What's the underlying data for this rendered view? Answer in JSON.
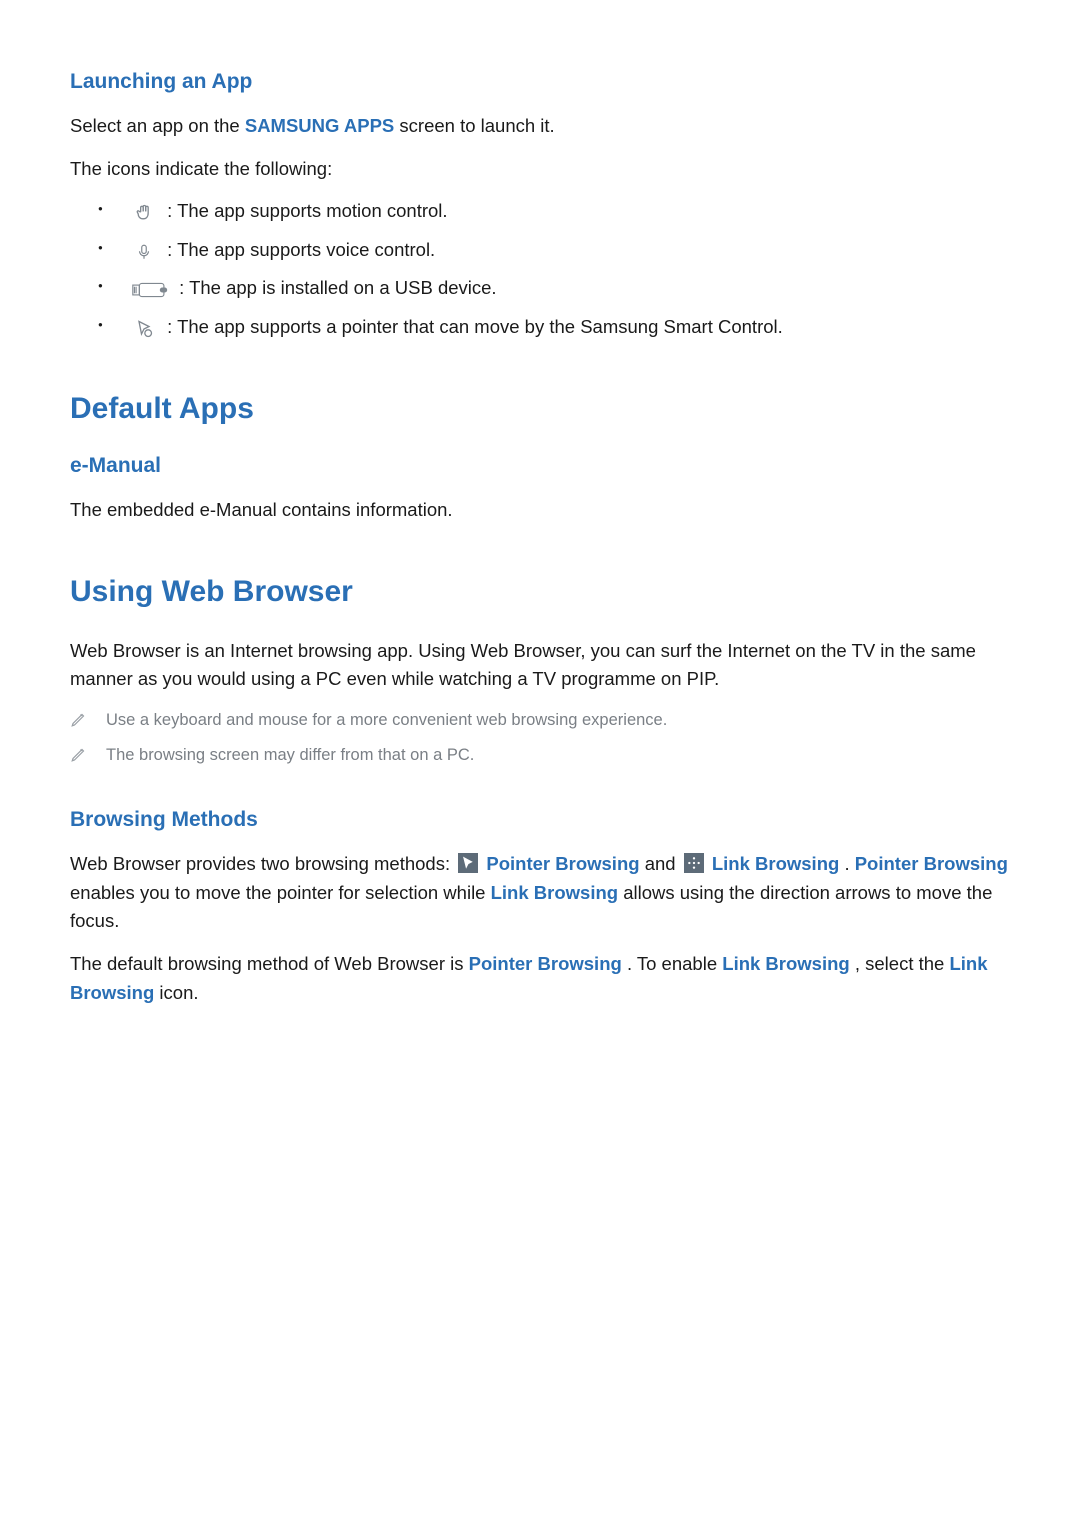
{
  "launching": {
    "heading": "Launching an App",
    "intro_prefix": "Select an app on the ",
    "intro_link": "SAMSUNG APPS",
    "intro_suffix": " screen to launch it.",
    "icons_intro": "The icons indicate the following:",
    "items": [
      {
        "icon": "hand-icon",
        "text": " : The app supports motion control."
      },
      {
        "icon": "mic-icon",
        "text": " : The app supports voice control."
      },
      {
        "icon": "usb-icon",
        "text": " : The app is installed on a USB device."
      },
      {
        "icon": "pointer-icon",
        "text": " : The app supports a pointer that can move by the Samsung Smart Control."
      }
    ]
  },
  "default_apps": {
    "heading": "Default Apps",
    "emanual_heading": "e-Manual",
    "emanual_text": "The embedded e-Manual contains information."
  },
  "web_browser": {
    "heading": "Using Web Browser",
    "text": "Web Browser is an Internet browsing app. Using Web Browser, you can surf the Internet on the TV in the same manner as you would using a PC even while watching a TV programme on PIP.",
    "notes": [
      "Use a keyboard and mouse for a more convenient web browsing experience.",
      "The browsing screen may differ from that on a PC."
    ]
  },
  "browsing_methods": {
    "heading": "Browsing Methods",
    "p1_segments": {
      "s0": "Web Browser provides two browsing methods: ",
      "s1": "Pointer Browsing",
      "s2": " and ",
      "s3": "Link Browsing",
      "s4": ". ",
      "s5": "Pointer Browsing",
      "s6": " enables you to move the pointer for selection while ",
      "s7": "Link Browsing",
      "s8": " allows using the direction arrows to move the focus."
    },
    "p2_segments": {
      "s0": "The default browsing method of Web Browser is ",
      "s1": "Pointer Browsing",
      "s2": ". To enable ",
      "s3": "Link Browsing",
      "s4": ", select the ",
      "s5": "Link Browsing",
      "s6": " icon."
    }
  }
}
